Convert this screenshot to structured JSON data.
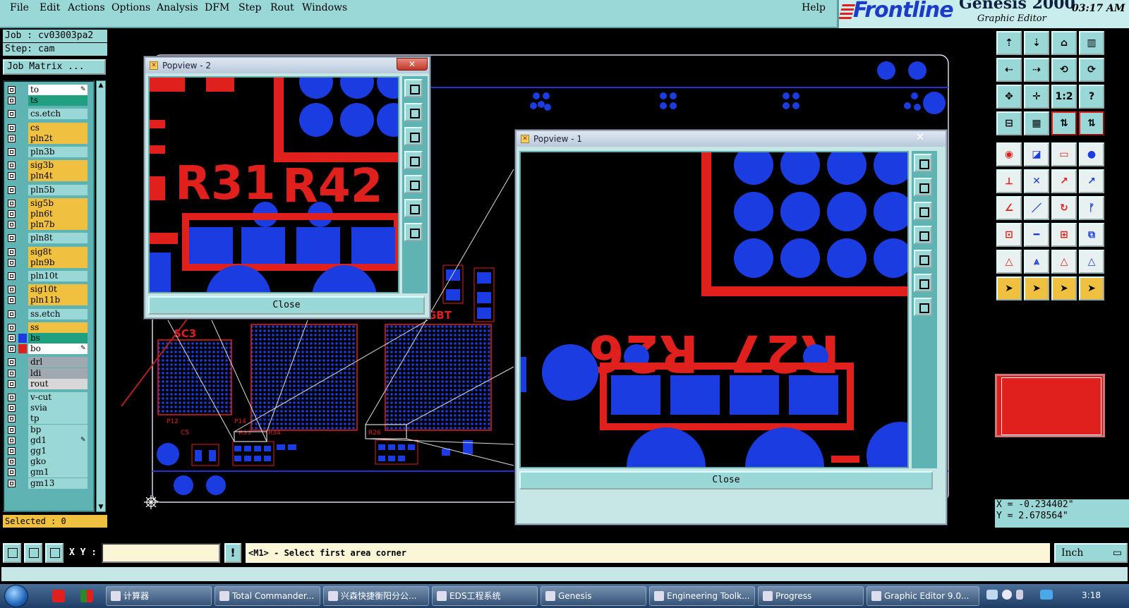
{
  "menu": {
    "items": [
      {
        "key": "file",
        "label": "File"
      },
      {
        "key": "edit",
        "label": "Edit"
      },
      {
        "key": "actions",
        "label": "Actions"
      },
      {
        "key": "options",
        "label": "Options"
      },
      {
        "key": "analysis",
        "label": "Analysis"
      },
      {
        "key": "dfm",
        "label": "DFM"
      },
      {
        "key": "step",
        "label": "Step"
      },
      {
        "key": "rout",
        "label": "Rout"
      },
      {
        "key": "windows",
        "label": "Windows"
      }
    ],
    "help": "Help"
  },
  "brand": {
    "logo": "Frontline",
    "product": "Genesis 2000",
    "subtitle": "Graphic Editor",
    "time": "03:17 AM"
  },
  "job": {
    "job_label": "Job : cv03003pa2",
    "step_label": "Step: cam",
    "matrix_button": "Job Matrix ..."
  },
  "layers": [
    {
      "name": "to",
      "color": "#ffffff",
      "mark": "✎",
      "group": 0
    },
    {
      "name": "ts",
      "color": "#20a080",
      "group": 0
    },
    {
      "name": "cs.etch",
      "color": "#9ad8d8",
      "group": 1
    },
    {
      "name": "cs",
      "color": "#f0c040",
      "group": 2
    },
    {
      "name": "pln2t",
      "color": "#f0c040",
      "group": 2
    },
    {
      "name": "pln3b",
      "color": "#9ad8d8",
      "group": 3
    },
    {
      "name": "sig3b",
      "color": "#f0c040",
      "group": 4
    },
    {
      "name": "pln4t",
      "color": "#f0c040",
      "group": 4
    },
    {
      "name": "pln5b",
      "color": "#9ad8d8",
      "group": 5
    },
    {
      "name": "sig5b",
      "color": "#f0c040",
      "group": 6
    },
    {
      "name": "pln6t",
      "color": "#f0c040",
      "group": 6
    },
    {
      "name": "pln7b",
      "color": "#f0c040",
      "group": 6
    },
    {
      "name": "pln8t",
      "color": "#9ad8d8",
      "group": 7
    },
    {
      "name": "sig8t",
      "color": "#f0c040",
      "group": 8
    },
    {
      "name": "pln9b",
      "color": "#f0c040",
      "group": 8
    },
    {
      "name": "pln10t",
      "color": "#9ad8d8",
      "group": 9
    },
    {
      "name": "sig10t",
      "color": "#f0c040",
      "group": 10
    },
    {
      "name": "pln11b",
      "color": "#f0c040",
      "group": 10
    },
    {
      "name": "ss.etch",
      "color": "#9ad8d8",
      "group": 11
    },
    {
      "name": "ss",
      "color": "#f0c040",
      "group": 12
    },
    {
      "name": "bs",
      "color": "#20a080",
      "swatch": "#1a3ce0",
      "group": 12
    },
    {
      "name": "bo",
      "color": "#ffffff",
      "swatch": "#e0201c",
      "mark": "✎",
      "active": true,
      "group": 12
    },
    {
      "name": "drl",
      "color": "#a0a8b0",
      "group": 13
    },
    {
      "name": "ldi",
      "color": "#a0a8b0",
      "group": 13
    },
    {
      "name": "rout",
      "color": "#d8d8d8",
      "group": 13
    },
    {
      "name": "v-cut",
      "color": "#9ad8d8",
      "group": 14
    },
    {
      "name": "svia",
      "color": "#9ad8d8",
      "group": 14
    },
    {
      "name": "tp",
      "color": "#9ad8d8",
      "group": 14
    },
    {
      "name": "bp",
      "color": "#9ad8d8",
      "group": 14
    },
    {
      "name": "gd1",
      "color": "#9ad8d8",
      "mark": "✎",
      "group": 14
    },
    {
      "name": "gg1",
      "color": "#9ad8d8",
      "group": 14
    },
    {
      "name": "gko",
      "color": "#9ad8d8",
      "group": 14
    },
    {
      "name": "gm1",
      "color": "#9ad8d8",
      "group": 14
    },
    {
      "name": "gm13",
      "color": "#9ad8d8",
      "group": 14
    }
  ],
  "selected": "Selected : 0",
  "board_labels": {
    "gbt": "GBT",
    "scs": "SC3",
    "pins": [
      "P12",
      "P14",
      "R33",
      "R34",
      "R26",
      "C5"
    ]
  },
  "popview2": {
    "title": "Popview - 2",
    "close": "Close",
    "labels": [
      "R31",
      "R42"
    ]
  },
  "popview1": {
    "title": "Popview - 1",
    "close": "Close",
    "labels": [
      "R26",
      "R27"
    ]
  },
  "coords": {
    "x": "X = -0.234402\"",
    "y": "Y = 2.678564\""
  },
  "cmd": {
    "xy_label": "X Y :",
    "xy_value": "",
    "prompt": "<M1> - Select first area corner",
    "units": "Inch"
  },
  "taskbar": {
    "tasks": [
      "计算器",
      "Total Commander...",
      "兴森快捷衡阳分公...",
      "EDS工程系统",
      "Genesis",
      "Engineering Toolk...",
      "Progress",
      "Graphic Editor 9.0..."
    ],
    "clock": "3:18"
  },
  "colors": {
    "panel": "#9ad8d8",
    "layer_yellow": "#f0c040",
    "copper_red": "#e0201c",
    "pad_blue": "#1a3ce0",
    "brand_blue": "#1a3cc8"
  }
}
